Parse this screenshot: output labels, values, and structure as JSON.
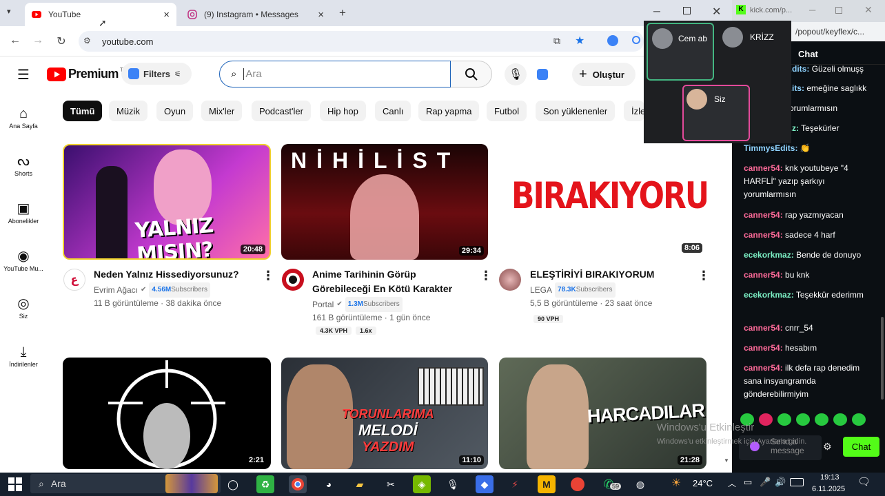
{
  "browser": {
    "tabs": [
      {
        "label": "YouTube"
      },
      {
        "label": "(9) Instagram • Messages"
      }
    ],
    "url": "youtube.com"
  },
  "youtube": {
    "logo_text": "Premium",
    "logo_sup": "TR",
    "filters_label": "Filters",
    "search_placeholder": "Ara",
    "create_label": "Oluştur",
    "categories": [
      "Tümü",
      "Müzik",
      "Oyun",
      "Mix'ler",
      "Podcast'ler",
      "Hip hop",
      "Canlı",
      "Rap yapma",
      "Futbol",
      "Son yüklenenler",
      "İzle"
    ],
    "sidebar": [
      {
        "label": "Ana Sayfa",
        "icon": "home-icon"
      },
      {
        "label": "Shorts",
        "icon": "shorts-icon"
      },
      {
        "label": "Abonelikler",
        "icon": "subscriptions-icon"
      },
      {
        "label": "YouTube Mu...",
        "icon": "youtube-music-icon"
      },
      {
        "label": "Siz",
        "icon": "you-icon"
      },
      {
        "label": "İndirilenler",
        "icon": "downloads-icon"
      }
    ],
    "videos": [
      {
        "thumb_text": "YALNIZ MISIN?",
        "duration": "20:48",
        "title": "Neden Yalnız Hissediyorsunuz?",
        "channel": "Evrim Ağacı",
        "subs": "4.56M",
        "subs_label": "Subscribers",
        "meta": "11 B görüntüleme · 38 dakika önce"
      },
      {
        "thumb_text": "NİHİLİST",
        "duration": "29:34",
        "title_1": "Anime Tarihinin Görüp",
        "title_2": "Görebileceği En Kötü Karakter",
        "channel": "Portal",
        "subs": "1.3M",
        "subs_label": "Subscribers",
        "meta": "161 B görüntüleme · 1 gün önce",
        "vph": "4.3K VPH",
        "mult": "1.6x"
      },
      {
        "thumb_text": "BIRAKIYORUM",
        "duration": "8:06",
        "title": "ELEŞTİRİYİ BIRAKIYORUM",
        "channel": "LEGA",
        "subs": "78.3K",
        "subs_label": "Subscribers",
        "meta": "5,5 B görüntüleme · 23 saat önce",
        "vph": "90 VPH"
      },
      {
        "duration": "2:21"
      },
      {
        "thumb_text_1": "TORUNLARIMA",
        "thumb_text_2": "MELODİ",
        "thumb_text_3": "YAZDIM",
        "duration": "11:10"
      },
      {
        "thumb_text": "HARCADILAR",
        "duration": "21:28"
      }
    ]
  },
  "kick": {
    "url": "kick.com/p...",
    "url_full": "/popout/keyflex/c...",
    "chat_header": "Chat",
    "messages": [
      {
        "user": "...dits:",
        "text": "Güzeli olmuşş"
      },
      {
        "user": "...its:",
        "text": "emeğine saglıkk"
      },
      {
        "user": "",
        "text": "yorumlarmısın"
      },
      {
        "user": "...z:",
        "text": "Teşekürler"
      },
      {
        "user": "TimmysEdits:",
        "text": "👏"
      },
      {
        "user": "canner54:",
        "text": "knk youtubeye \"4 HARFLİ\" yazıp şarkıyı yorumlarmısın"
      },
      {
        "user": "canner54:",
        "text": "rap yazmıyacan"
      },
      {
        "user": "canner54:",
        "text": "sadece 4 harf"
      },
      {
        "user": "ecekorkmaz:",
        "text": "Bende de donuyo"
      },
      {
        "user": "canner54:",
        "text": "bu knk"
      },
      {
        "user": "ecekorkmaz:",
        "text": "Teşekkür ederimm"
      },
      {
        "user": "canner54:",
        "text": "cnrr_54"
      },
      {
        "user": "canner54:",
        "text": "hesabım"
      },
      {
        "user": "canner54:",
        "text": "ilk defa rap denedim sana insyangramda gönderebilirmiyim"
      }
    ],
    "send_label": "Chat",
    "input_placeholder": "Send a message",
    "watermark_1": "Windows'u Etkinleştir",
    "watermark_2": "Windows'u etkinleştirmek için Ayarlar'a gidin."
  },
  "discord": {
    "participants": [
      {
        "name": "Cem ab"
      },
      {
        "name": "KRİZZ"
      },
      {
        "name": "Siz"
      }
    ]
  },
  "taskbar": {
    "search_label": "Ara",
    "whatsapp_badge": "59",
    "weather": "24°C",
    "time": "19:13",
    "date": "6.11.2025"
  }
}
